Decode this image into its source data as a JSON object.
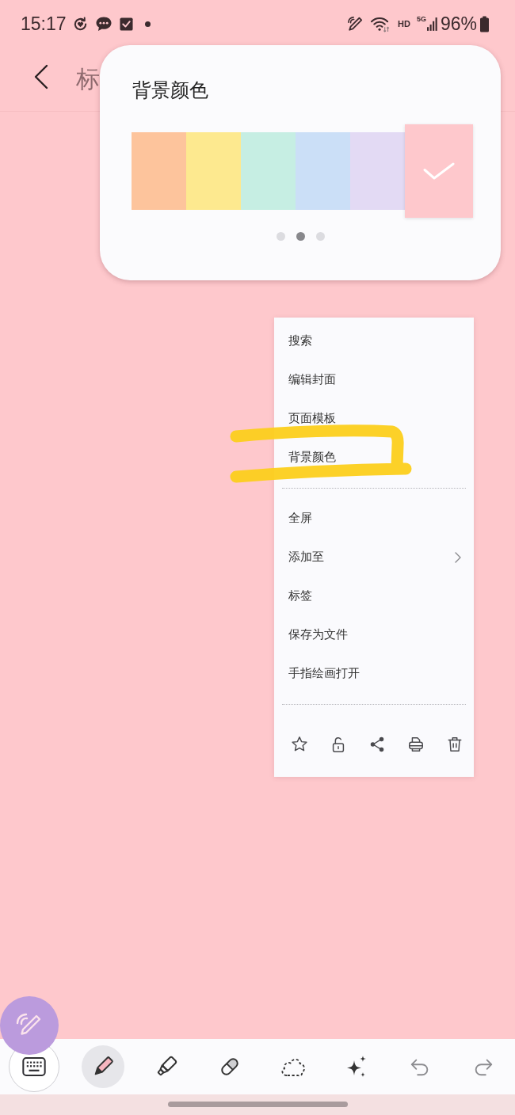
{
  "status_bar": {
    "time": "15:17",
    "network_label": "HD",
    "network_type": "5G",
    "battery": "96%"
  },
  "header": {
    "title": "标"
  },
  "popup": {
    "title": "背景颜色",
    "swatches": [
      {
        "color": "#fdc49c",
        "selected": false
      },
      {
        "color": "#fde98f",
        "selected": false
      },
      {
        "color": "#c6eee3",
        "selected": false
      },
      {
        "color": "#cbdff7",
        "selected": false
      },
      {
        "color": "#e3daf4",
        "selected": false
      },
      {
        "color": "#fec8cc",
        "selected": true
      }
    ],
    "pages": [
      {
        "selected": false
      },
      {
        "selected": true
      },
      {
        "selected": false
      }
    ]
  },
  "menu": {
    "groups": [
      {
        "items": [
          {
            "label": "搜索",
            "has_submenu": false
          },
          {
            "label": "编辑封面",
            "has_submenu": false
          },
          {
            "label": "页面模板",
            "has_submenu": false
          },
          {
            "label": "背景颜色",
            "has_submenu": false
          }
        ]
      },
      {
        "items": [
          {
            "label": "全屏",
            "has_submenu": false
          },
          {
            "label": "添加至",
            "has_submenu": true
          },
          {
            "label": "标签",
            "has_submenu": false
          },
          {
            "label": "保存为文件",
            "has_submenu": false
          },
          {
            "label": "手指绘画打开",
            "has_submenu": false
          }
        ]
      }
    ],
    "actions": [
      {
        "kind": "star"
      },
      {
        "kind": "unlock"
      },
      {
        "kind": "share"
      },
      {
        "kind": "print"
      },
      {
        "kind": "delete"
      }
    ]
  },
  "toolbar": {
    "tools": [
      {
        "kind": "keyboard",
        "selected": false
      },
      {
        "kind": "pen",
        "selected": true
      },
      {
        "kind": "highlighter",
        "selected": false
      },
      {
        "kind": "eraser",
        "selected": false
      },
      {
        "kind": "lasso",
        "selected": false
      },
      {
        "kind": "sparkle",
        "selected": false
      },
      {
        "kind": "undo",
        "selected": false
      },
      {
        "kind": "redo",
        "selected": false
      }
    ]
  }
}
